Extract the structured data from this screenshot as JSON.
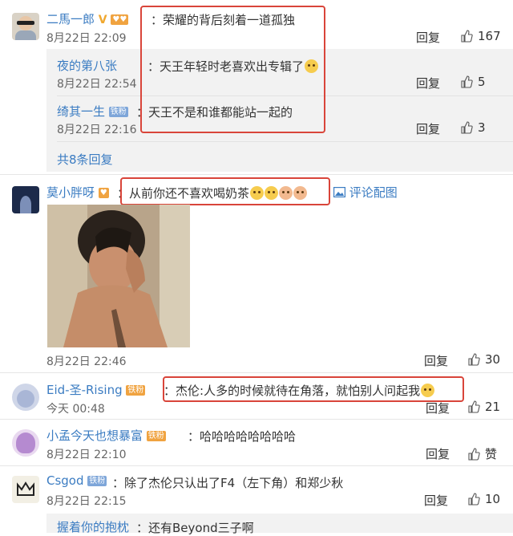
{
  "colors": {
    "link": "#3b7cc2",
    "highlight_box": "#d9453a",
    "sub_bg": "#f2f2f2"
  },
  "comments": [
    {
      "user": "二馬一郎",
      "text": "荣耀的背后刻着一道孤独",
      "time": "8月22日 22:09",
      "reply_label": "回复",
      "likes": "167",
      "badge": "V",
      "replies": [
        {
          "user": "夜的第八张",
          "text": "天王年轻时老喜欢出专辑了",
          "time": "8月22日 22:54",
          "reply_label": "回复",
          "likes": "5"
        },
        {
          "user": "绮其一生",
          "badge": "铁粉",
          "text": "天王不是和谁都能站一起的",
          "time": "8月22日 22:16",
          "reply_label": "回复",
          "likes": "3"
        }
      ],
      "more_replies": "共8条回复"
    },
    {
      "user": "莫小胖呀",
      "text": "从前你还不喜欢喝奶茶",
      "image_link": "评论配图",
      "time": "8月22日 22:46",
      "reply_label": "回复",
      "likes": "30"
    },
    {
      "user": "Eid-圣-Rising",
      "badge": "铁粉",
      "text": "杰伦:人多的时候就待在角落，就怕别人问起我",
      "time": "今天 00:48",
      "reply_label": "回复",
      "likes": "21"
    },
    {
      "user": "小孟今天也想暴富",
      "badge": "铁粉",
      "text": "哈哈哈哈哈哈哈哈",
      "time": "8月22日 22:10",
      "reply_label": "回复",
      "likes": "赞"
    },
    {
      "user": "Csgod",
      "badge": "铁粉",
      "text": "除了杰伦只认出了F4（左下角）和郑少秋",
      "time": "8月22日 22:15",
      "reply_label": "回复",
      "likes": "10",
      "reply_preview_user": "握着你的抱枕",
      "reply_preview_text": "：还有Beyond三子啊"
    }
  ]
}
